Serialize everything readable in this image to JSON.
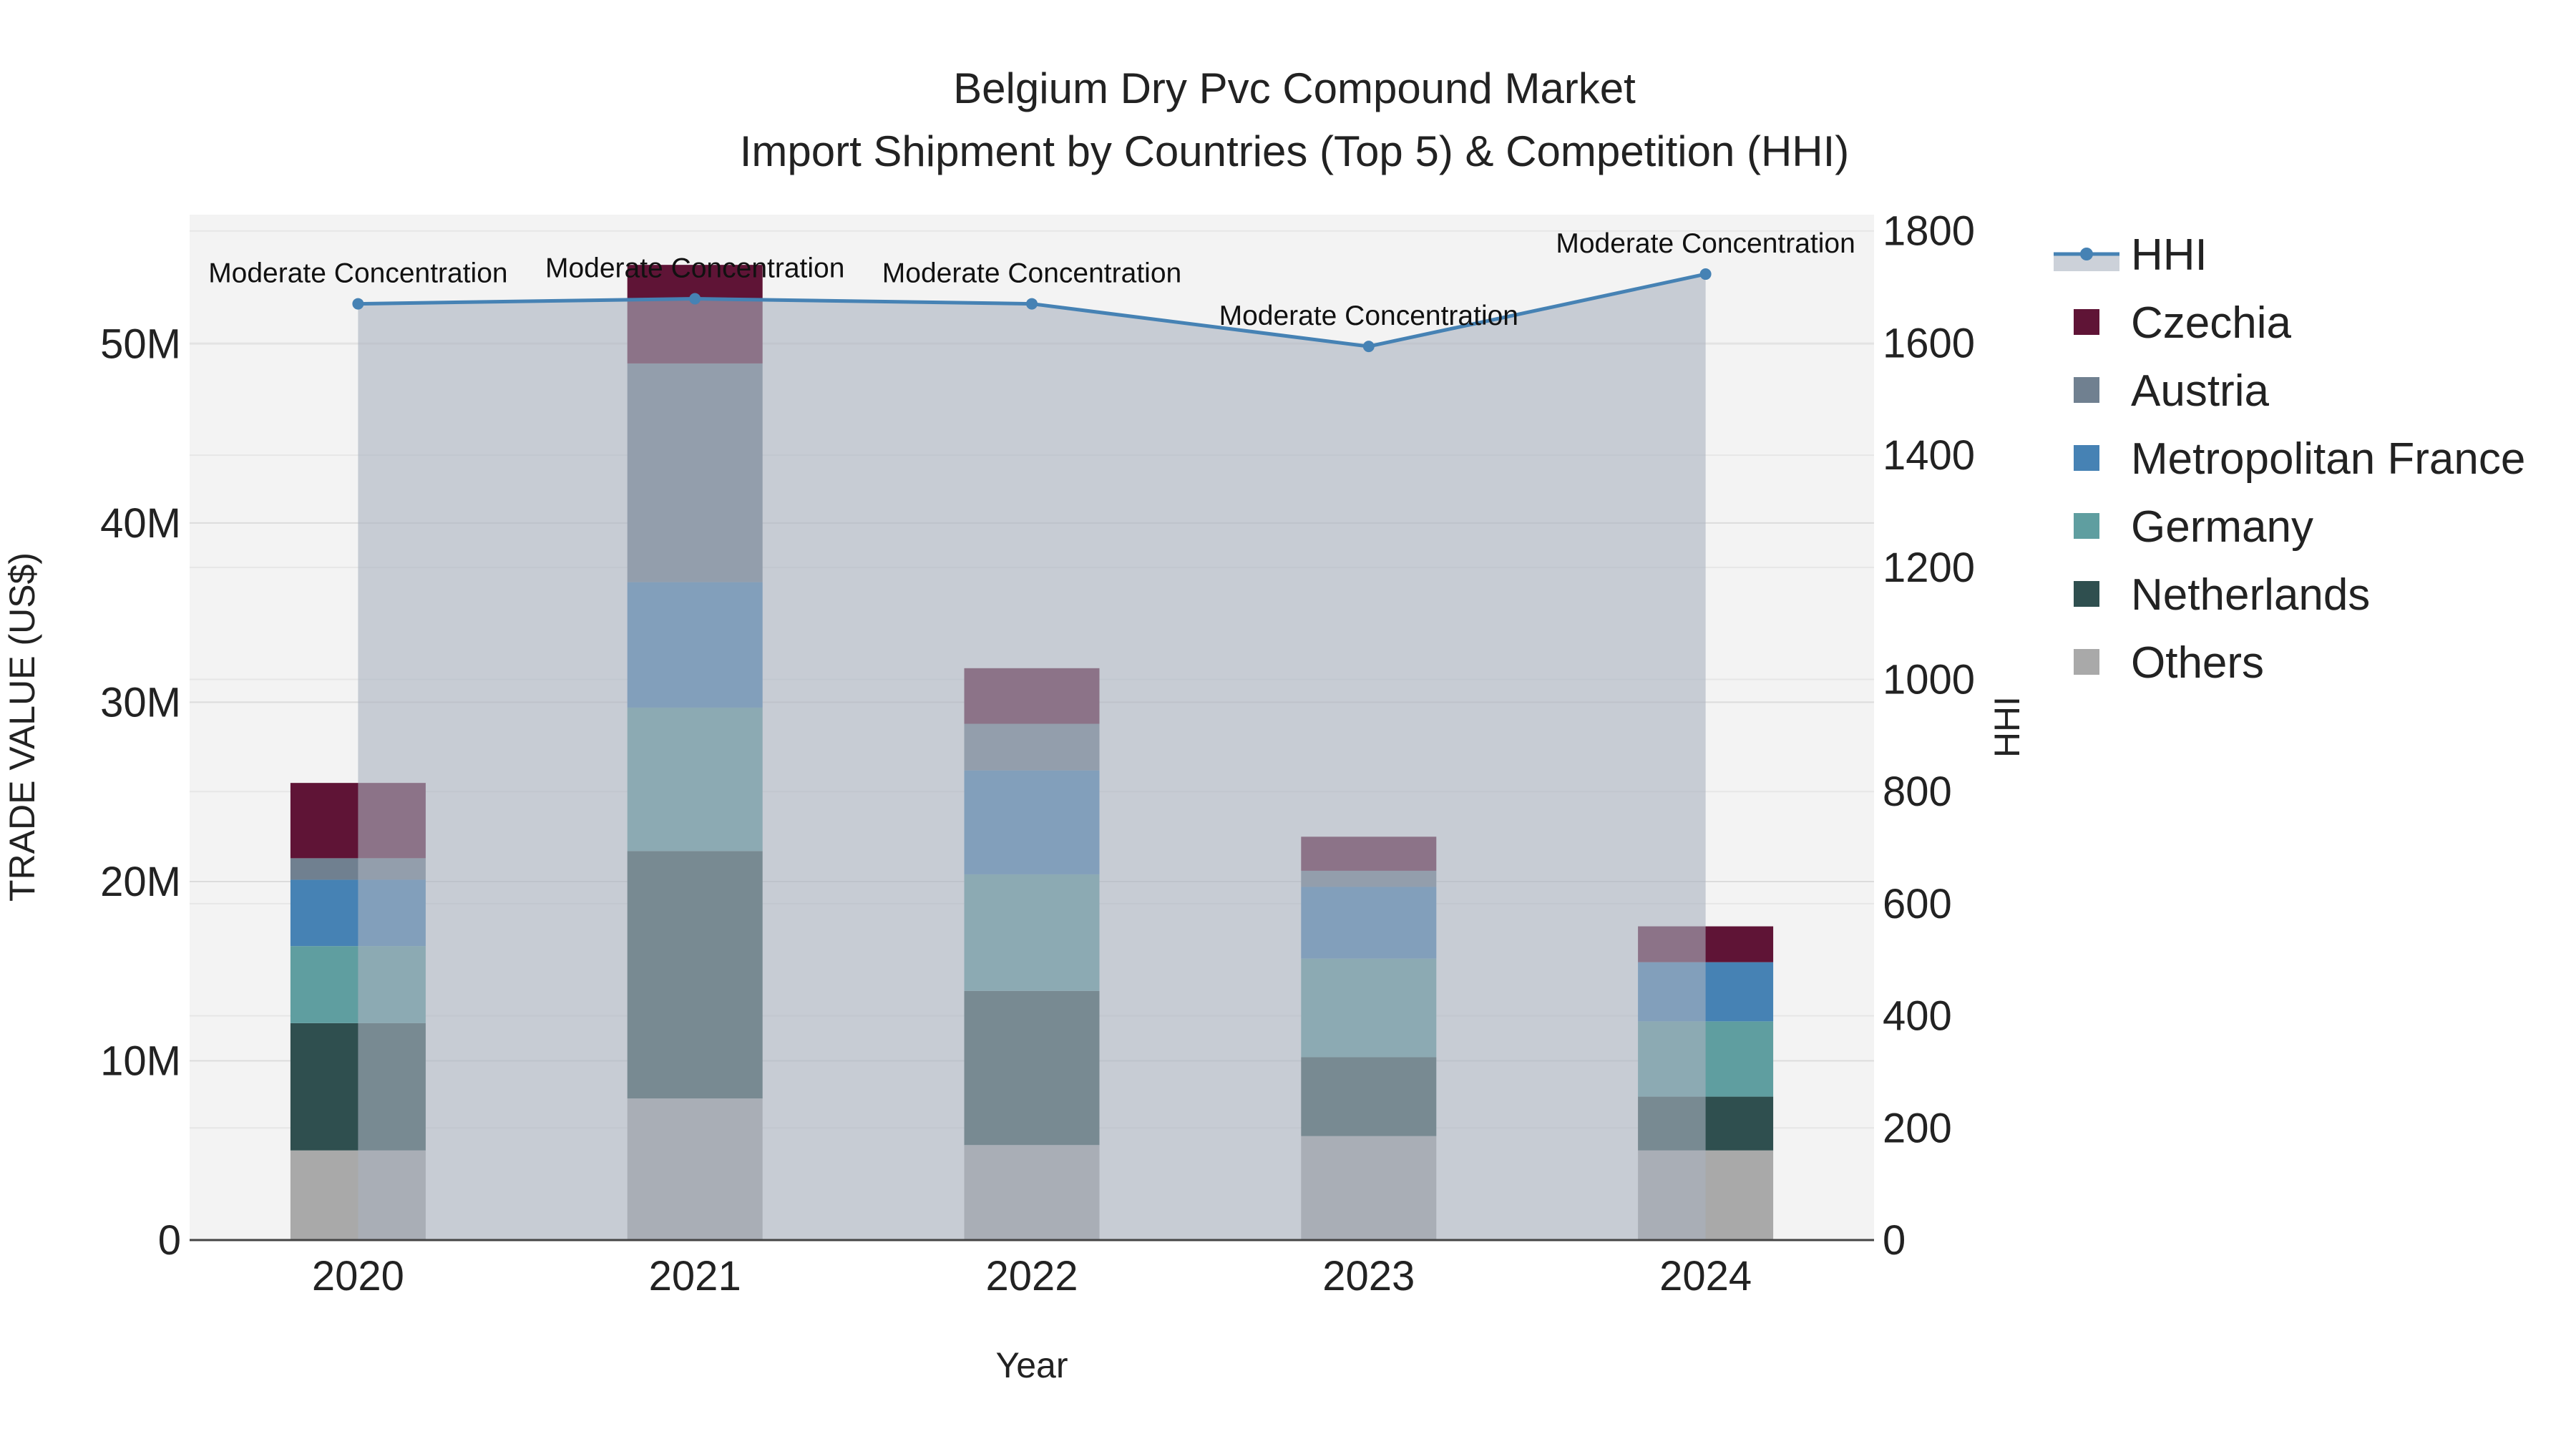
{
  "chart_data": {
    "type": "bar",
    "title": "Belgium Dry Pvc Compound Market",
    "subtitle": "Import Shipment by Countries (Top 5) & Competition (HHI)",
    "xlabel": "Year",
    "ylabel": "TRADE VALUE (US$)",
    "y2label": "HHI",
    "categories": [
      "2020",
      "2021",
      "2022",
      "2023",
      "2024"
    ],
    "ylim": [
      0,
      57200000
    ],
    "y2lim": [
      0,
      1829
    ],
    "yticks": [
      0,
      10000000,
      20000000,
      30000000,
      40000000,
      50000000
    ],
    "ytick_labels": [
      "0",
      "10M",
      "20M",
      "30M",
      "40M",
      "50M"
    ],
    "y2ticks": [
      0,
      200,
      400,
      600,
      800,
      1000,
      1200,
      1400,
      1600,
      1800
    ],
    "y2tick_labels": [
      "0",
      "200",
      "400",
      "600",
      "800",
      "1000",
      "1200",
      "1400",
      "1600",
      "1800"
    ],
    "grid": true,
    "legend_position": "right",
    "series": [
      {
        "name": "Others",
        "color": "#a9a9a9",
        "values": [
          5000000,
          7900000,
          5300000,
          5800000,
          5000000
        ]
      },
      {
        "name": "Netherlands",
        "color": "#2f4f4f",
        "values": [
          7100000,
          13800000,
          8600000,
          4400000,
          3000000
        ]
      },
      {
        "name": "Germany",
        "color": "#5f9ea0",
        "values": [
          4300000,
          8000000,
          6500000,
          5500000,
          4200000
        ]
      },
      {
        "name": "Metropolitan France",
        "color": "#4682b4",
        "values": [
          3700000,
          7000000,
          5800000,
          4000000,
          3300000
        ]
      },
      {
        "name": "Austria",
        "color": "#708090",
        "values": [
          1200000,
          12200000,
          2600000,
          900000,
          0
        ]
      },
      {
        "name": "Czechia",
        "color": "#5f1436",
        "values": [
          4200000,
          5500000,
          3100000,
          1900000,
          2000000
        ]
      }
    ],
    "hhi": {
      "name": "HHI",
      "color": "#4682b4",
      "values": [
        1670,
        1679,
        1670,
        1594,
        1723
      ],
      "annotations": [
        "Moderate Concentration",
        "Moderate Concentration",
        "Moderate Concentration",
        "Moderate Concentration",
        "Moderate Concentration"
      ]
    },
    "legend_order": [
      "HHI",
      "Czechia",
      "Austria",
      "Metropolitan France",
      "Germany",
      "Netherlands",
      "Others"
    ]
  }
}
